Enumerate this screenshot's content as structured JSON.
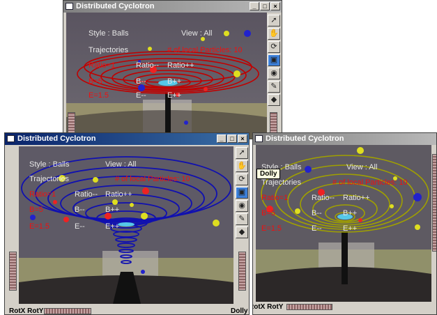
{
  "windows": {
    "back": {
      "title": "Distributed Cyclotron",
      "style": "Style : Balls",
      "view": "View : All",
      "trajectories": "Trajectories",
      "particles": "# of local Particles: 10",
      "ratio": "Ratio=1",
      "ratio_dec": "Ratio--",
      "ratio_inc": "Ratio++",
      "b": "B=5",
      "b_dec": "B--",
      "b_inc": "B++",
      "e": "E=1.5",
      "e_dec": "E--",
      "e_inc": "E++",
      "trail_color": "#c00000"
    },
    "front": {
      "title": "Distributed Cyclotron",
      "style": "Style : Balls",
      "view": "View : All",
      "trajectories": "Trajectories",
      "particles": "# of local Particles: 10",
      "ratio": "Ratio=1",
      "ratio_dec": "Ratio--",
      "ratio_inc": "Ratio++",
      "b": "B=5",
      "b_dec": "B--",
      "b_inc": "B++",
      "e": "E=1.5",
      "e_dec": "E--",
      "e_inc": "E++",
      "rot_label": "RotX RotY",
      "dolly_label": "Dolly",
      "trail_color": "#1010b0"
    },
    "right": {
      "title": "Distributed Cyclotron",
      "style": "Style : Balls",
      "view": "View : All",
      "trajectories": "Trajectories",
      "particles": "# of local Particles: 10",
      "ratio": "Ratio=1",
      "ratio_dec": "Ratio--",
      "ratio_inc": "Ratio++",
      "b": "B=5",
      "b_dec": "B--",
      "b_inc": "B++",
      "e": "E=1.5",
      "e_dec": "E--",
      "e_inc": "E++",
      "rot_label": "RotX RotY",
      "trail_color": "#a0a000"
    }
  },
  "tooltip": "Dolly",
  "title_buttons": {
    "minimize": "_",
    "maximize": "□",
    "close": "×"
  },
  "tools": [
    {
      "name": "pointer-arrow-icon",
      "glyph": "➚"
    },
    {
      "name": "hand-pan-icon",
      "glyph": "✋"
    },
    {
      "name": "rotate-view-icon",
      "glyph": "⟳"
    },
    {
      "name": "zoom-box-icon",
      "glyph": "▣"
    },
    {
      "name": "eye-view-icon",
      "glyph": "◉"
    },
    {
      "name": "brush-icon",
      "glyph": "✎"
    },
    {
      "name": "shield-icon",
      "glyph": "◆"
    }
  ]
}
